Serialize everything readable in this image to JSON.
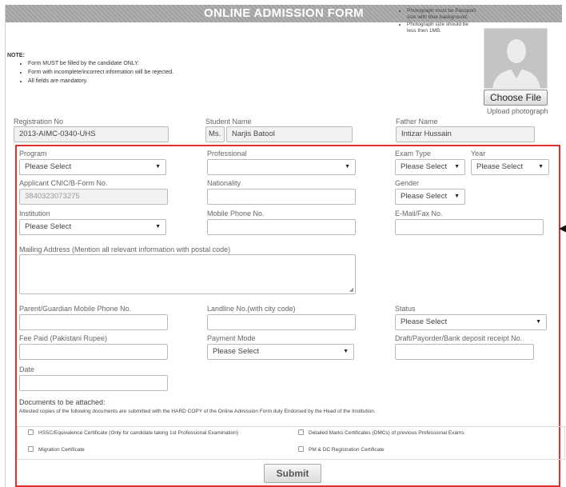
{
  "header": {
    "title": "ONLINE ADMISSION FORM"
  },
  "note": {
    "title": "NOTE:",
    "items": [
      "Form MUST be filled by the candidate ONLY.",
      "Form with incomplete/incorrect information will be rejected.",
      "All fields are mandatory."
    ]
  },
  "photo": {
    "notes": [
      "Photograph must be Passport size with blue background.",
      "Photograph size should be less then 1MB."
    ],
    "choose_file_label": "Choose File",
    "upload_label": "Upload photograph"
  },
  "fields": {
    "registration_no": {
      "label": "Registration No",
      "value": "2013-AIMC-0340-UHS"
    },
    "student_name": {
      "label": "Student Name",
      "title": "Ms.",
      "value": "Narjis Batool"
    },
    "father_name": {
      "label": "Father Name",
      "value": "Intizar Hussain"
    },
    "program": {
      "label": "Program",
      "value": "Please Select"
    },
    "professional": {
      "label": "Professional",
      "value": ""
    },
    "exam_type": {
      "label": "Exam Type",
      "value": "Please Select"
    },
    "year": {
      "label": "Year",
      "value": "Please Select"
    },
    "cnic": {
      "label": "Applicant CNIC/B-Form No.",
      "value": "3840323073275"
    },
    "nationality": {
      "label": "Nationality",
      "value": ""
    },
    "gender": {
      "label": "Gender",
      "value": "Please Select"
    },
    "institution": {
      "label": "Institution",
      "value": "Please Select"
    },
    "mobile": {
      "label": "Mobile Phone No.",
      "value": ""
    },
    "email": {
      "label": "E-Mail/Fax No.",
      "value": ""
    },
    "mailing_address": {
      "label": "Mailing Address (Mention all relevant information with postal code)",
      "value": ""
    },
    "guardian_mobile": {
      "label": "Parent/Guardian Mobile Phone No.",
      "value": ""
    },
    "landline": {
      "label": "Landline No.(with city code)",
      "value": ""
    },
    "status": {
      "label": "Status",
      "value": "Please Select"
    },
    "fee_paid": {
      "label": "Fee Paid (Pakistani Rupee)",
      "value": ""
    },
    "payment_mode": {
      "label": "Payment Mode",
      "value": "Please Select"
    },
    "receipt_no": {
      "label": "Draft/Payorder/Bank deposit receipt No.",
      "value": ""
    },
    "date": {
      "label": "Date",
      "value": ""
    }
  },
  "documents": {
    "title": "Documents to be attached:",
    "note": "Attested copies of the following documents are submitted with the HARD COPY of the Online Admission Form duly Endorsed by the Head of the Institution.",
    "items": [
      "HSSC/Equivalence Certificate (Only for candidate taking 1st Professional Examination)",
      "Detailed Marks Certificates (DMCs) of previous Professional Exams",
      "Migration Certificate",
      "PM & DC Registration Certificate"
    ]
  },
  "submit_label": "Submit",
  "icons": {
    "dropdown": "dropdown-arrow-icon",
    "photo_placeholder": "avatar-placeholder-icon",
    "pointer": "pointer-arrow-icon"
  },
  "colors": {
    "header_bg": "#a8a8a8",
    "highlight_border": "#e03030"
  }
}
